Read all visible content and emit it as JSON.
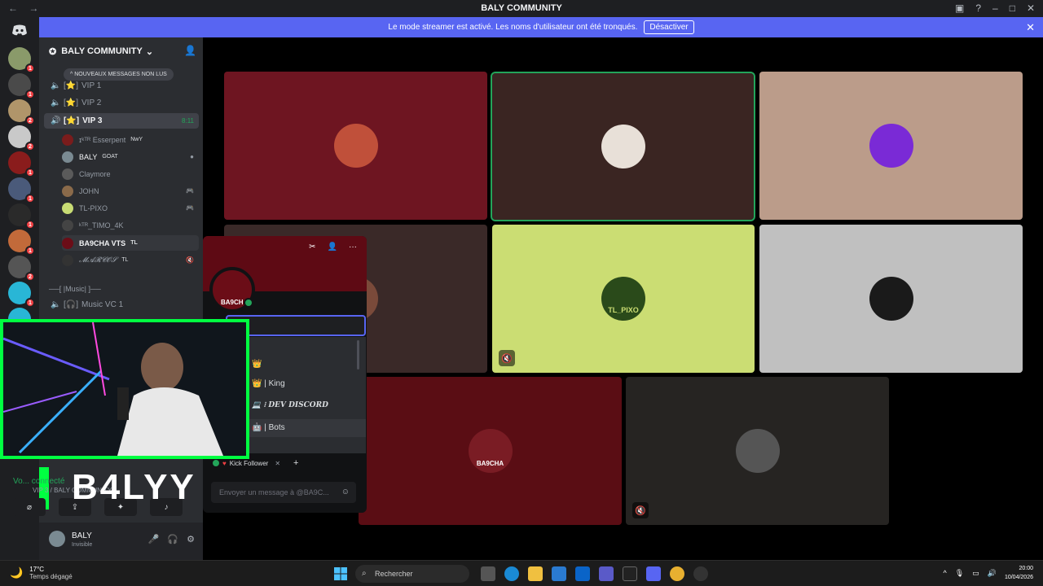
{
  "window": {
    "title": "BALY COMMUNITY"
  },
  "banner": {
    "text": "Le mode streamer est activé. Les noms d'utilisateur ont été tronqués.",
    "button": "Désactiver"
  },
  "server": {
    "name": "BALY COMMUNITY"
  },
  "unread_pill": "NOUVEAUX MESSAGES NON LUS",
  "channels": [
    {
      "label": "VIP 1"
    },
    {
      "label": "VIP 2"
    },
    {
      "label": "VIP 3",
      "time": "8:11"
    }
  ],
  "members": [
    {
      "name": "ɪᵏᵀᴿ Esserpent",
      "tag": "NwY"
    },
    {
      "name": "BALY",
      "tag": "GOAT"
    },
    {
      "name": "Claymore",
      "tag": ""
    },
    {
      "name": "JOHN",
      "tag": ""
    },
    {
      "name": "TL-PIXO",
      "tag": ""
    },
    {
      "name": "ᵏᵀᴿ_TIMO_4K",
      "tag": ""
    },
    {
      "name": "BA9CHA VTS",
      "tag": "TL"
    },
    {
      "name": "𝓜𝓐𝓡𝓒𝓞𝓢",
      "tag": "TL"
    }
  ],
  "music_section": "|Music|",
  "music_channel": "Music VC 1",
  "profile": {
    "avatar_label": "BA9CH",
    "roles": [
      "King",
      "DEV DISCORD",
      "Bots"
    ],
    "chip": "Kick Follower",
    "message_placeholder": "Envoyer un message à @BA9C..."
  },
  "overlay": {
    "text": "B4LYY"
  },
  "voice": {
    "status": "Vo... connecté",
    "channel": "VIP 3 / BALY COMMUNITY"
  },
  "user": {
    "name": "BALY",
    "status": "Invisible"
  },
  "tiles": [
    {
      "label": ""
    },
    {
      "label": ""
    },
    {
      "label": ""
    },
    {
      "label": ""
    },
    {
      "label": "TL_PIXO"
    },
    {
      "label": ""
    },
    {
      "label": "BA9CHA"
    },
    {
      "label": ""
    }
  ],
  "taskbar": {
    "temp": "17°C",
    "weather": "Temps dégagé",
    "search": "Rechercher",
    "time": "20:00",
    "date": "10/04/2026"
  },
  "colors": {
    "brand": "#5865f2",
    "online": "#23a55a",
    "cam_border": "#00ff41"
  }
}
